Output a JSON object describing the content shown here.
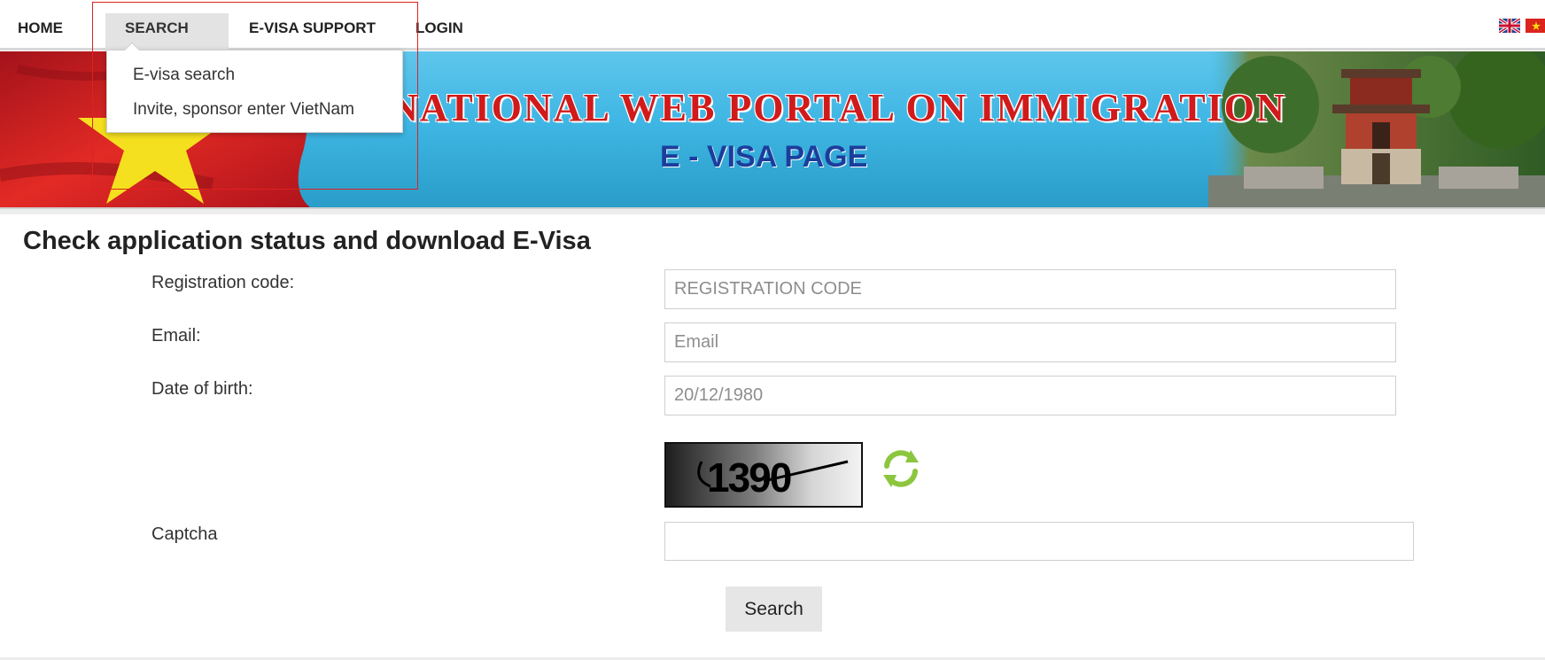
{
  "nav": {
    "home": "HOME",
    "search": "SEARCH",
    "support": "E-VISA SUPPORT",
    "login": "LOGIN"
  },
  "languages": [
    {
      "name": "english-flag-icon"
    },
    {
      "name": "vietnam-flag-icon"
    }
  ],
  "dropdown": {
    "items": [
      "E-visa search",
      "Invite, sponsor enter VietNam"
    ]
  },
  "banner": {
    "title": "NATIONAL WEB PORTAL ON IMMIGRATION",
    "subtitle": "E - VISA PAGE"
  },
  "form": {
    "title": "Check application status and download E-Visa",
    "registration_label": "Registration code:",
    "registration_placeholder": "REGISTRATION CODE",
    "email_label": "Email:",
    "email_placeholder": "Email",
    "dob_label": "Date of birth:",
    "dob_placeholder": "20/12/1980",
    "captcha_label": "Captcha",
    "captcha_text": "1390",
    "search_button": "Search"
  },
  "colors": {
    "accent_red": "#d11a1a",
    "accent_blue": "#1a3e9c",
    "banner_blue": "#3fb6e4",
    "highlight": "#e02020",
    "refresh_green": "#8cc63f"
  }
}
